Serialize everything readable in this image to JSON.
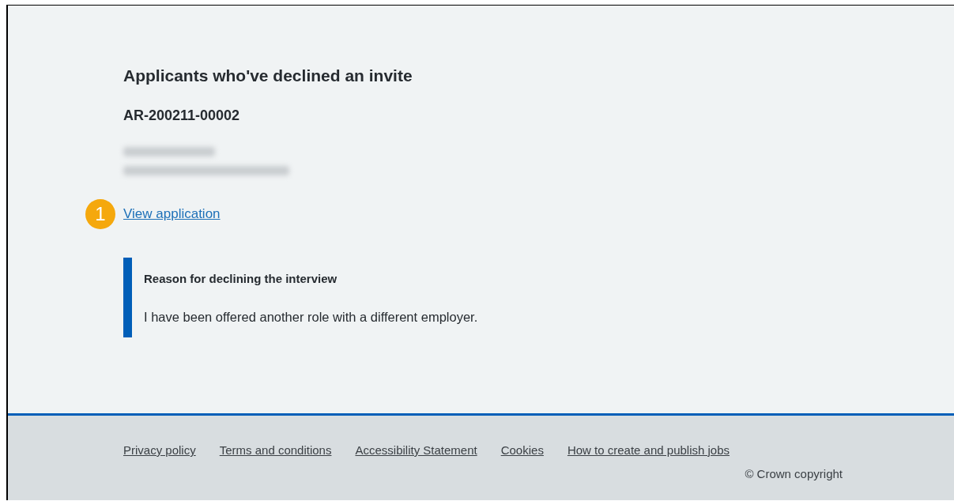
{
  "page": {
    "heading": "Applicants who've declined an invite",
    "reference": "AR-200211-00002",
    "annotation_marker": "1",
    "link": "View application"
  },
  "reason_panel": {
    "title": "Reason for declining the interview",
    "text": "I have been offered another role with a different employer."
  },
  "footer": {
    "links": [
      "Privacy policy",
      "Terms and conditions",
      "Accessibility Statement",
      "Cookies",
      "How to create and publish jobs"
    ],
    "copyright": "© Crown copyright"
  }
}
